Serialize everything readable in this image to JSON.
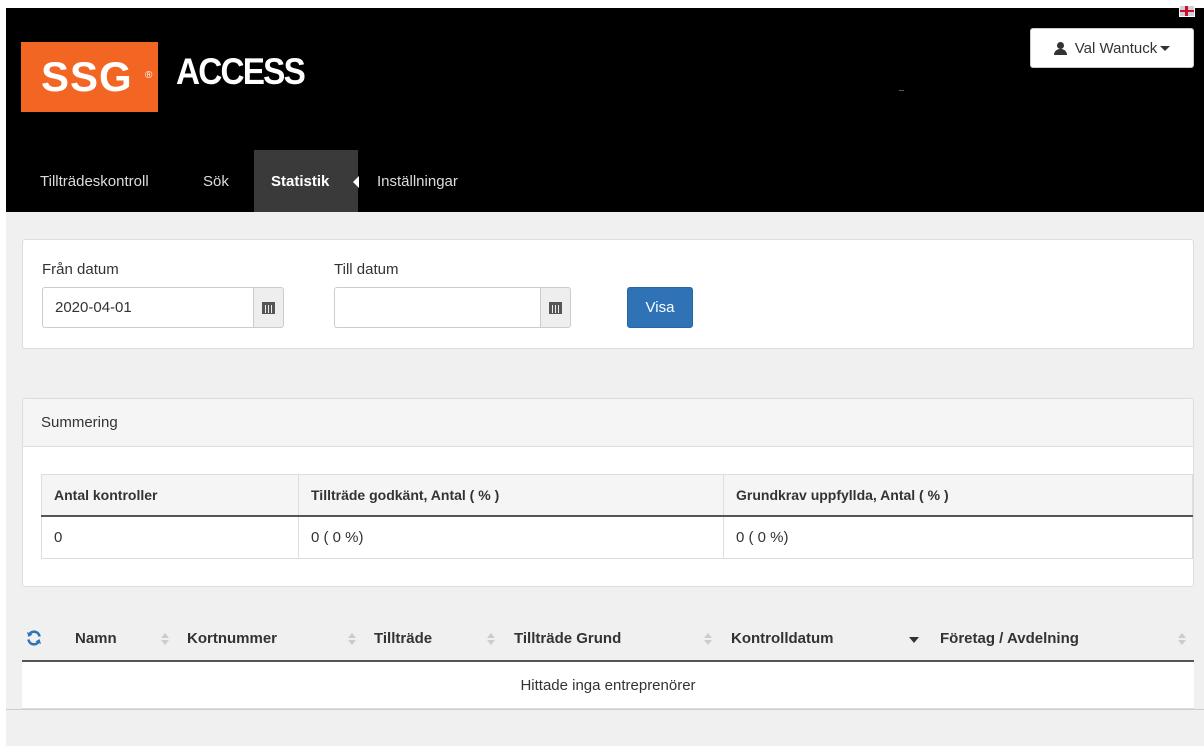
{
  "brand": {
    "logo_text": "SSG",
    "logo_reg": "®",
    "product": "ACCESS",
    "logo_color": "#f26522"
  },
  "user": {
    "name": "Val Wantuck"
  },
  "nav": {
    "items": [
      {
        "label": "Tillträdeskontroll"
      },
      {
        "label": "Sök"
      },
      {
        "label": "Statistik",
        "active": true
      },
      {
        "label": "Inställningar"
      }
    ]
  },
  "filter": {
    "from_label": "Från datum",
    "from_value": "2020-04-01",
    "to_label": "Till datum",
    "to_value": "",
    "submit_label": "Visa",
    "accent": "#2f72b5"
  },
  "summary": {
    "title": "Summering",
    "headers": [
      "Antal kontroller",
      "Tillträde godkänt, Antal ( % )",
      "Grundkrav uppfyllda, Antal ( % )"
    ],
    "row": [
      "0",
      "0 ( 0 %)",
      "0 ( 0 %)"
    ]
  },
  "grid": {
    "columns": [
      {
        "label": "Namn",
        "sort": "none"
      },
      {
        "label": "Kortnummer",
        "sort": "none"
      },
      {
        "label": "Tillträde",
        "sort": "none"
      },
      {
        "label": "Tillträde Grund",
        "sort": "none"
      },
      {
        "label": "Kontrolldatum",
        "sort": "desc"
      },
      {
        "label": "Företag / Avdelning",
        "sort": "none"
      }
    ],
    "empty_message": "Hittade inga entreprenörer"
  }
}
